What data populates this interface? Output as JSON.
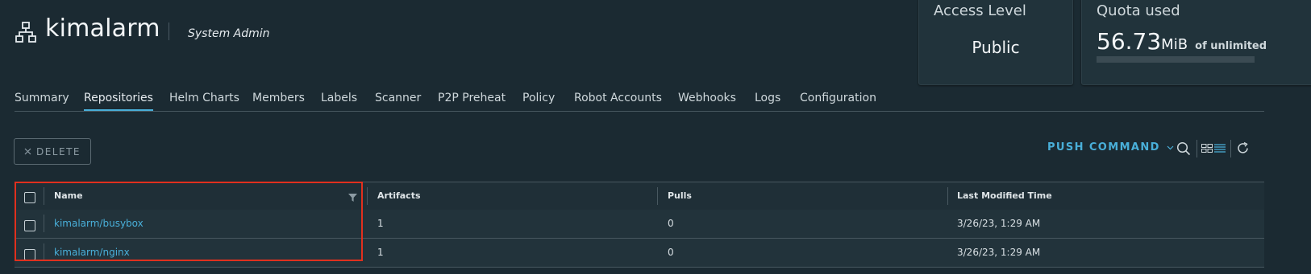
{
  "header": {
    "project_name": "kimalarm",
    "role": "System Admin",
    "project_icon": "project-tree-icon"
  },
  "cards": {
    "access": {
      "label": "Access Level",
      "value": "Public"
    },
    "quota": {
      "label": "Quota used",
      "amount": "56.73",
      "unit": "MiB",
      "of_text": "of unlimited",
      "used_fraction": 0
    }
  },
  "tabs": [
    {
      "label": "Summary"
    },
    {
      "label": "Repositories",
      "active": true
    },
    {
      "label": "Helm Charts"
    },
    {
      "label": "Members"
    },
    {
      "label": "Labels"
    },
    {
      "label": "Scanner"
    },
    {
      "label": "P2P Preheat"
    },
    {
      "label": "Policy"
    },
    {
      "label": "Robot Accounts"
    },
    {
      "label": "Webhooks"
    },
    {
      "label": "Logs"
    },
    {
      "label": "Configuration"
    }
  ],
  "toolbar": {
    "delete_label": "DELETE",
    "push_command_label": "PUSH COMMAND",
    "icons": [
      "close-icon",
      "chevron-down-icon",
      "search-icon",
      "card-view-icon",
      "list-view-icon",
      "refresh-icon"
    ]
  },
  "table": {
    "columns": [
      "Name",
      "Artifacts",
      "Pulls",
      "Last Modified Time"
    ],
    "rows": [
      {
        "name": "kimalarm/busybox",
        "artifacts": "1",
        "pulls": "0",
        "modified": "3/26/23, 1:29 AM"
      },
      {
        "name": "kimalarm/nginx",
        "artifacts": "1",
        "pulls": "0",
        "modified": "3/26/23, 1:29 AM"
      }
    ]
  },
  "colors": {
    "background": "#1b2a32",
    "accent": "#49afd9",
    "highlight_box": "#e0301e"
  }
}
